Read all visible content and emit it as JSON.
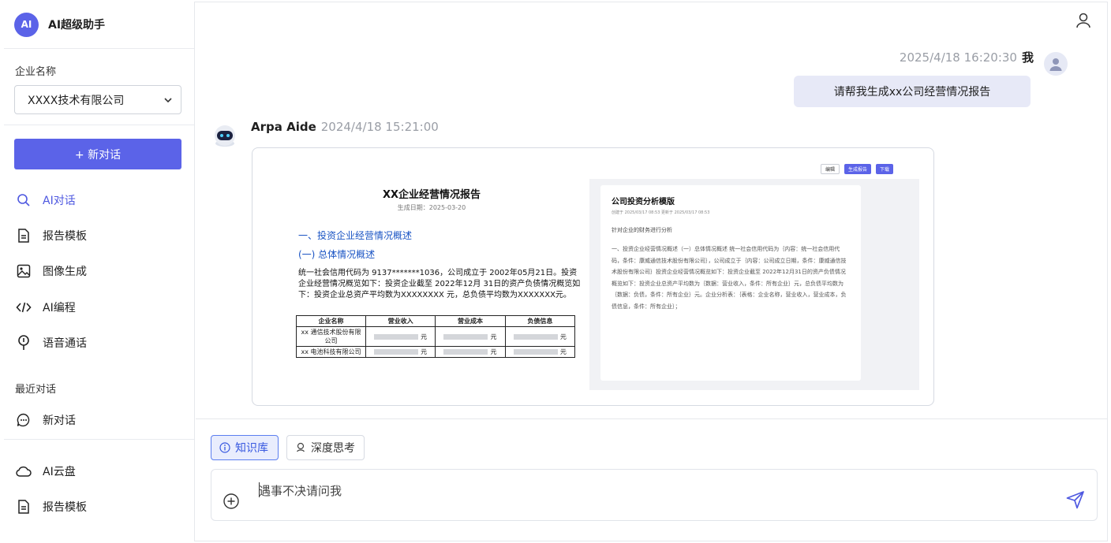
{
  "brand": {
    "logo": "AI",
    "name": "AI超级助手"
  },
  "company": {
    "label": "企业名称",
    "selected": "XXXX技术有限公司"
  },
  "sidebar": {
    "new_chat": "+ 新对话",
    "nav": [
      {
        "label": "AI对话",
        "icon": "search-icon",
        "active": true
      },
      {
        "label": "报告模板",
        "icon": "document-icon"
      },
      {
        "label": "图像生成",
        "icon": "image-icon"
      },
      {
        "label": "AI编程",
        "icon": "code-icon"
      },
      {
        "label": "语音通话",
        "icon": "microphone-icon"
      }
    ],
    "recent_label": "最近对话",
    "recent": [
      {
        "label": "新对话",
        "icon": "chat-bubble-icon"
      }
    ],
    "bottom": [
      {
        "label": "AI云盘",
        "icon": "cloud-icon"
      },
      {
        "label": "报告模板",
        "icon": "document-icon"
      }
    ]
  },
  "chat": {
    "user_msg": {
      "time": "2025/4/18 16:20:30",
      "sender": "我",
      "text": "请帮我生成xx公司经营情况报告"
    },
    "bot_msg": {
      "sender": "Arpa Aide",
      "time": "2024/4/18 15:21:00"
    }
  },
  "report": {
    "title": "XX企业经营情况报告",
    "date": "生成日期：2025-03-20",
    "h1": "一、投资企业经营情况概述",
    "h2": "(一) 总体情况概述",
    "paragraph": "统一社会信用代码为 9137*******1036，公司成立于 2002年05月21日。投资企业经营情况概览如下：投资企业截至 2022年12月 31日的资产负债情况概览如下：投资企业总资产平均数为XXXXXXXX 元，总负债平均数为XXXXXXX元。",
    "table": {
      "headers": [
        "企业名称",
        "营业收入",
        "营业成本",
        "负债信息"
      ],
      "rows": [
        {
          "name": "xx 通信技术股份有限公司",
          "unit": "元"
        },
        {
          "name": "xx 电池科技有限公司",
          "unit": "元"
        }
      ]
    }
  },
  "template": {
    "toolbar": {
      "edit": "编辑",
      "generate": "生成报告",
      "download": "下载"
    },
    "title": "公司投资分析模版",
    "meta": "创建于 2025/03/17 08:53    更新于 2025/03/17 08:53",
    "line": "针对企业的财务进行分析",
    "body": "一、投资企业经营情况概述（一）总体情况概述 统一社会信用代码为｛内容：统一社会信用代码，条件：康威通信技术股份有限公司｝，公司成立于｛内容：公司成立日期，条件：康威通信技术股份有限公司｝投资企业经营情况概览如下：投资企业截至 2022年12月31日的资产负债情况概览如下：投资企业总资产平均数为｛数据：营业收入，条件：所有企业｝元，总负债平均数为｛数据：负债，条件：所有企业｝元。企业分析表：｛表格：企业名称，营业收入，营业成本，负债信息，条件：所有企业｝；"
  },
  "composer": {
    "chips": [
      {
        "label": "知识库",
        "icon": "info-icon"
      },
      {
        "label": "深度思考",
        "icon": "thinking-icon"
      }
    ],
    "placeholder": "遇事不决请问我"
  },
  "colors": {
    "accent": "#5b63e8",
    "bubble": "#e7e9f7",
    "link": "#1a54c4"
  }
}
